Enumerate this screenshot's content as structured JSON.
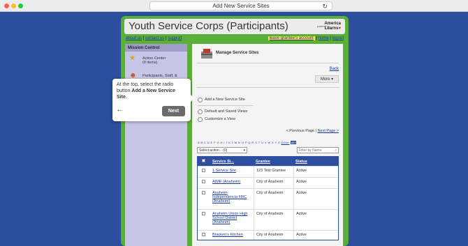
{
  "browser": {
    "title": "Add New Service Sites"
  },
  "app": {
    "title": "Youth Service Corps (Participants)",
    "powered_by": "powered by",
    "logo_line1": "America",
    "logo_line2": "Learns"
  },
  "nav": {
    "about": "about us",
    "contact": "contact us",
    "support": "support",
    "leave": "leave grantee's account",
    "home": "home",
    "logout": "logout"
  },
  "sidebar": {
    "heading": "Mission Control",
    "action_center": "Action Center",
    "action_items": "(0 items)",
    "participants": "Participants, Staff, &"
  },
  "page": {
    "title": "Manage Service Sites",
    "back": "Back",
    "more": "More",
    "radio1": "Add a New Service Site",
    "radio2": "Default and Saved Views",
    "radio3": "Customize a View",
    "prev": "< Previous Page",
    "sep": " | ",
    "next": "Next Page >",
    "alphabet": "A B C D E F G H I J K L M N O P Q R S T U V W X Y Z",
    "other": "Other",
    "all": "All",
    "select_action": "Select action... (0)",
    "filter_placeholder": "Filter by Name"
  },
  "table": {
    "headers": [
      "Service Si...",
      "Grantee",
      "Status"
    ],
    "rows": [
      {
        "site": "1 Service Site",
        "grantee": "123 Test Grantee",
        "status": "Active"
      },
      {
        "site": "AIME (Anaheim)",
        "grantee": "City of Anaheim",
        "status": "Active"
      },
      {
        "site": "Anaheim Independencia FRC (Anaheim)",
        "grantee": "City of Anaheim",
        "status": "Active"
      },
      {
        "site": "Anaheim Union High School District (Anaheim)",
        "grantee": "City of Anaheim",
        "status": "Active"
      },
      {
        "site": "Bracken's Kitchen",
        "grantee": "City of Anaheim",
        "status": "Active"
      }
    ]
  },
  "tooltip": {
    "text_a": "At the top, select the radio button ",
    "text_b": "Add a New Service Site",
    "text_c": ".",
    "next": "Next"
  },
  "colors": {
    "background": "#2b4f9e",
    "frame": "#5aae3a",
    "table_header": "#2e4fa0",
    "highlight": "#f5e642"
  }
}
